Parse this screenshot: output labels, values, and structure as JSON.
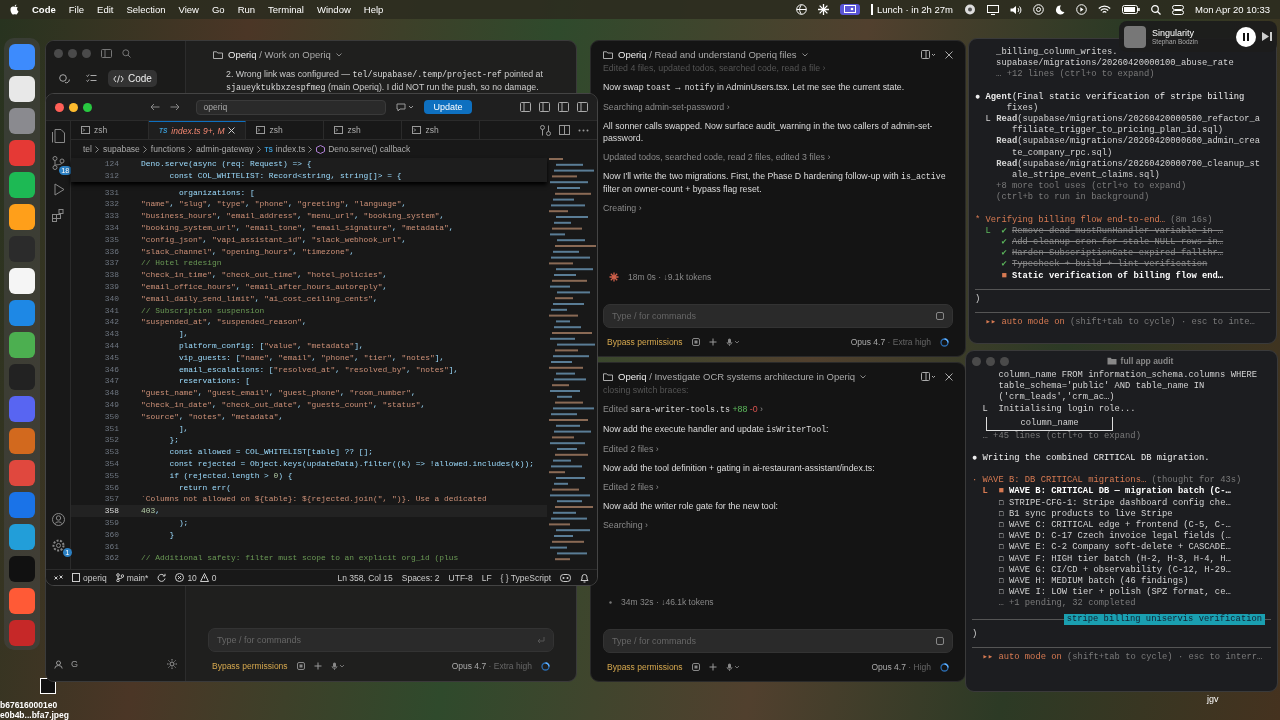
{
  "menubar": {
    "app_name": "Code",
    "menus": [
      "File",
      "Edit",
      "Selection",
      "View",
      "Go",
      "Run",
      "Terminal",
      "Window",
      "Help"
    ],
    "event": "Lunch · in 2h 27m",
    "clock": "Mon Apr 20  10:33"
  },
  "now_playing": {
    "title": "Singularity",
    "artist": "Stephan Bodzin"
  },
  "desktop_files": [
    "b676160001e0",
    "e0b4b...bfa7.jpeg",
    "jgv"
  ],
  "back_window": {
    "title": "**Operiq** / Work on Operiq",
    "mode_tabs": [
      {
        "kind": "chat",
        "selected": false
      },
      {
        "kind": "tasks",
        "selected": false
      },
      {
        "kind": "code",
        "label": "Code",
        "selected": true
      }
    ],
    "account_initial": "G",
    "message": [
      {
        "kind": "plain",
        "text": "2. Wrong link was configured — "
      },
      {
        "kind": "code",
        "text": "tel/supabase/.temp/project-ref"
      },
      {
        "kind": "plain",
        "text": " pointed at "
      },
      {
        "kind": "code",
        "text": "sjaueyktukbxzespfmeg"
      },
      {
        "kind": "plain",
        "text": " (main Operiq). I did NOT run the push, so no damage."
      }
    ],
    "input_placeholder": "Type / for commands",
    "mode": "Bypass permissions",
    "model": "Opus 4.7",
    "effort": "· Extra high"
  },
  "vscode": {
    "search": "operiq",
    "update_button": "Update",
    "tabs": [
      {
        "kind": "terminal",
        "label": "zsh",
        "selected": false
      },
      {
        "kind": "typescript",
        "icon_text": "TS",
        "label": "index.ts",
        "badge": "9+, M",
        "selected": true
      },
      {
        "kind": "terminal",
        "label": "zsh",
        "selected": false
      },
      {
        "kind": "terminal",
        "label": "zsh",
        "selected": false
      },
      {
        "kind": "terminal",
        "label": "zsh",
        "selected": false
      }
    ],
    "breadcrumb": [
      {
        "kind": "folder",
        "label": "tel"
      },
      {
        "kind": "folder",
        "label": "supabase"
      },
      {
        "kind": "folder",
        "label": "functions"
      },
      {
        "kind": "folder",
        "label": "admin-gateway"
      },
      {
        "kind": "typescript",
        "icon_text": "TS",
        "label": "index.ts"
      },
      {
        "kind": "symbol",
        "label": "Deno.serve() callback"
      }
    ],
    "activity_bar": [
      {
        "kind": "explorer"
      },
      {
        "kind": "source_control",
        "badge": "18"
      },
      {
        "kind": "debug"
      },
      {
        "kind": "extensions"
      },
      {
        "kind": "account"
      },
      {
        "kind": "settings",
        "badge": "1"
      }
    ],
    "sticky_lines": [
      {
        "n": "124",
        "text": "Deno.serve(async (req: Request) => {"
      },
      {
        "n": "312",
        "text": "      const COL_WHITELIST: Record<string, string[]> = {"
      }
    ],
    "lines": [
      {
        "n": "331",
        "text": "        organizations: [",
        "current": false
      },
      {
        "n": "332",
        "text": "          \"name\", \"slug\", \"type\", \"phone\", \"greeting\", \"language\",",
        "current": false
      },
      {
        "n": "333",
        "text": "          \"business_hours\", \"email_address\", \"menu_url\", \"booking_system\",",
        "current": false
      },
      {
        "n": "334",
        "text": "          \"booking_system_url\", \"email_tone\", \"email_signature\", \"metadata\",",
        "current": false
      },
      {
        "n": "335",
        "text": "          \"config_json\", \"vapi_assistant_id\", \"slack_webhook_url\",",
        "current": false
      },
      {
        "n": "336",
        "text": "          \"slack_channel\", \"opening_hours\", \"timezone\",",
        "current": false
      },
      {
        "n": "337",
        "text": "          // Hotel redesign",
        "current": false
      },
      {
        "n": "338",
        "text": "          \"check_in_time\", \"check_out_time\", \"hotel_policies\",",
        "current": false
      },
      {
        "n": "339",
        "text": "          \"email_office_hours\", \"email_after_hours_autoreply\",",
        "current": false
      },
      {
        "n": "340",
        "text": "          \"email_daily_send_limit\", \"ai_cost_ceiling_cents\",",
        "current": false
      },
      {
        "n": "341",
        "text": "          // Subscription suspension",
        "current": false
      },
      {
        "n": "342",
        "text": "          \"suspended_at\", \"suspended_reason\",",
        "current": false
      },
      {
        "n": "343",
        "text": "        ],",
        "current": false
      },
      {
        "n": "344",
        "text": "        platform_config: [\"value\", \"metadata\"],",
        "current": false
      },
      {
        "n": "345",
        "text": "        vip_guests: [\"name\", \"email\", \"phone\", \"tier\", \"notes\"],",
        "current": false
      },
      {
        "n": "346",
        "text": "        email_escalations: [\"resolved_at\", \"resolved_by\", \"notes\"],",
        "current": false
      },
      {
        "n": "347",
        "text": "        reservations: [",
        "current": false
      },
      {
        "n": "348",
        "text": "          \"guest_name\", \"guest_email\", \"guest_phone\", \"room_number\",",
        "current": false
      },
      {
        "n": "349",
        "text": "          \"check_in_date\", \"check_out_date\", \"guests_count\", \"status\",",
        "current": false
      },
      {
        "n": "350",
        "text": "          \"source\", \"notes\", \"metadata\",",
        "current": false
      },
      {
        "n": "351",
        "text": "        ],",
        "current": false
      },
      {
        "n": "352",
        "text": "      };",
        "current": false
      },
      {
        "n": "353",
        "text": "      const allowed = COL_WHITELIST[table] ?? [];",
        "current": false
      },
      {
        "n": "354",
        "text": "      const rejected = Object.keys(updateData).filter((k) => !allowed.includes(k));",
        "current": false
      },
      {
        "n": "355",
        "text": "      if (rejected.length > 0) {",
        "current": false
      },
      {
        "n": "356",
        "text": "        return err(",
        "current": false
      },
      {
        "n": "357",
        "text": "          `Columns not allowed on ${table}: ${rejected.join(\", \")}. Use a dedicated",
        "current": false
      },
      {
        "n": "358",
        "text": "          403,",
        "current": true
      },
      {
        "n": "359",
        "text": "        );",
        "current": false
      },
      {
        "n": "360",
        "text": "      }",
        "current": false
      },
      {
        "n": "361",
        "current": false
      },
      {
        "n": "362",
        "text": "      // Additional safety: filter must scope to an explicit org_id (plus",
        "current": false
      }
    ],
    "status": {
      "repo": "operiq",
      "branch": "main*",
      "errors": "10",
      "warnings": "0",
      "position": "Ln 358, Col 15",
      "indent": "Spaces: 2",
      "encoding": "UTF-8",
      "eol": "LF",
      "language_icon": "{ }",
      "language": "TypeScript"
    }
  },
  "chat_panels": [
    {
      "title": "**Operiq** / Read and understand Operiq files",
      "messages": [
        {
          "kind": "faded",
          "parts": [
            {
              "kind": "plain",
              "text": "Edited 4 files, updated todos, searched code, read a file ›"
            }
          ]
        },
        {
          "kind": "text",
          "parts": [
            {
              "kind": "plain",
              "text": "Now swap "
            },
            {
              "kind": "code",
              "text": "toast"
            },
            {
              "kind": "plain",
              "text": " → "
            },
            {
              "kind": "code",
              "text": "notify"
            },
            {
              "kind": "plain",
              "text": " in AdminUsers.tsx. Let me see the current state."
            }
          ]
        },
        {
          "kind": "tool",
          "parts": [
            {
              "kind": "plain",
              "text": "Searching admin-set-password ›"
            }
          ]
        },
        {
          "kind": "text",
          "parts": [
            {
              "kind": "plain",
              "text": "All sonner calls swapped. Now surface audit_warning in the two callers of admin-set-password."
            }
          ]
        },
        {
          "kind": "tool",
          "parts": [
            {
              "kind": "plain",
              "text": "Updated todos, searched code, read 2 files, edited 3 files ›"
            }
          ]
        },
        {
          "kind": "text",
          "parts": [
            {
              "kind": "plain",
              "text": "Now I'll write the two migrations. First, the Phase D hardening follow-up with "
            },
            {
              "kind": "code",
              "text": "is_active"
            },
            {
              "kind": "plain",
              "text": " filter on owner-count + bypass flag reset."
            }
          ]
        },
        {
          "kind": "tool",
          "parts": [
            {
              "kind": "plain",
              "text": "Creating ›"
            }
          ]
        }
      ],
      "stats": "18m 0s · ↓9.1k tokens",
      "working": true,
      "input_placeholder": "Type / for commands",
      "mode": "Bypass permissions",
      "model": "Opus 4.7",
      "effort": "· Extra high"
    },
    {
      "title": "**Operiq** / Investigate OCR systems architecture in Operiq",
      "messages": [
        {
          "kind": "faded",
          "parts": [
            {
              "kind": "plain",
              "text": "closing switch braces:"
            }
          ]
        },
        {
          "kind": "tool",
          "parts": [
            {
              "kind": "plain",
              "text": "Edited "
            },
            {
              "kind": "code",
              "text": "sara-writer-tools.ts"
            },
            {
              "kind": "added",
              "text": " +88"
            },
            {
              "kind": "removed",
              "text": " -0"
            },
            {
              "kind": "plain",
              "text": " ›"
            }
          ]
        },
        {
          "kind": "text",
          "parts": [
            {
              "kind": "plain",
              "text": "Now add the execute handler and update "
            },
            {
              "kind": "code",
              "text": "isWriterTool"
            },
            {
              "kind": "plain",
              "text": ":"
            }
          ]
        },
        {
          "kind": "tool",
          "parts": [
            {
              "kind": "plain",
              "text": "Edited 2 files ›"
            }
          ]
        },
        {
          "kind": "text",
          "parts": [
            {
              "kind": "plain",
              "text": "Now add the tool definition + gating in ai-restaurant-assistant/index.ts:"
            }
          ]
        },
        {
          "kind": "tool",
          "parts": [
            {
              "kind": "plain",
              "text": "Edited 2 files ›"
            }
          ]
        },
        {
          "kind": "text",
          "parts": [
            {
              "kind": "plain",
              "text": "Now add the writer role gate for the new tool:"
            }
          ]
        },
        {
          "kind": "tool",
          "parts": [
            {
              "kind": "plain",
              "text": "Searching ›"
            }
          ]
        }
      ],
      "stats": "34m 32s · ↓46.1k tokens",
      "working": false,
      "input_placeholder": "Type / for commands",
      "mode": "Bypass permissions",
      "model": "Opus 4.7",
      "effort": "· High"
    }
  ],
  "terminals": [
    {
      "lines": [
        {
          "kind": "out",
          "text": "    _billing_column_writes."
        },
        {
          "kind": "out",
          "text": "    supabase/migrations/20260420000100_abuse_rate"
        },
        {
          "kind": "dim",
          "text": "    … +12 lines (ctrl+o to expand)"
        },
        {
          "kind": "agent",
          "text": "● **Agent**(Final static verification of stripe billing"
        },
        {
          "kind": "out",
          "text": "      fixes)"
        },
        {
          "kind": "tool",
          "text": "  L **Read**(supabase/migrations/20260420000500_refactor_a"
        },
        {
          "kind": "out",
          "text": "       ffiliate_trigger_to_pricing_plan_id.sql)"
        },
        {
          "kind": "tool",
          "text": "    **Read**(supabase/migrations/20260420000600_admin_crea"
        },
        {
          "kind": "out",
          "text": "       te_company_rpc.sql)"
        },
        {
          "kind": "tool",
          "text": "    **Read**(supabase/migrations/20260420000700_cleanup_st"
        },
        {
          "kind": "out",
          "text": "       ale_stripe_event_claims.sql)"
        },
        {
          "kind": "dim",
          "text": "    +8 more tool uses (ctrl+o to expand)"
        },
        {
          "kind": "dim",
          "text": "    (ctrl+b to run in background)"
        },
        {
          "kind": "task",
          "text": "* Verifying billing flow end-to-end…",
          "meta": "(8m 16s)"
        },
        {
          "kind": "done",
          "prefix": "  L  ✔",
          "text": "Remove dead mustRunHandler variable in …"
        },
        {
          "kind": "done",
          "prefix": "     ✔",
          "text": "Add cleanup cron for stale NULL rows in…"
        },
        {
          "kind": "done",
          "prefix": "     ✔",
          "text": "Harden SubscriptionGate expired fallthr…"
        },
        {
          "kind": "done",
          "prefix": "     ✔",
          "text": "Typecheck + build + lint verification"
        },
        {
          "kind": "current",
          "prefix": "     ■",
          "text": "Static verification of billing flow end…"
        },
        {
          "kind": "rule"
        },
        {
          "kind": "out",
          "text": ")"
        },
        {
          "kind": "rule"
        },
        {
          "kind": "prompt",
          "mode": "  ▸▸ auto mode on",
          "hint": "(shift+tab to cycle) · esc to inte…"
        }
      ]
    },
    {
      "title": "full app audit",
      "lines": [
        {
          "kind": "out",
          "text": "     column_name FROM information_schema.columns WHERE"
        },
        {
          "kind": "out",
          "text": "     table_schema='public' AND table_name IN"
        },
        {
          "kind": "out",
          "text": "     ('crm_leads','crm_ac…)"
        },
        {
          "kind": "out",
          "text": "  L  Initialising login role..."
        },
        {
          "kind": "box",
          "text": "column_name"
        },
        {
          "kind": "dim",
          "text": "  … +45 lines (ctrl+o to expand)"
        },
        {
          "kind": "agent",
          "text": "● Writing the combined CRITICAL DB migration."
        },
        {
          "kind": "task",
          "text": "· WAVE B: DB CRITICAL migrations…",
          "meta": "(thought for 43s)"
        },
        {
          "kind": "current",
          "prefix": "  L  ■",
          "text": "WAVE B: CRITICAL DB — migration batch (C-…"
        },
        {
          "kind": "todo",
          "prefix": "     ☐",
          "text": "STRIPE-CFG-1: Stripe dashboard config che…"
        },
        {
          "kind": "todo",
          "prefix": "     ☐",
          "text": "B1 sync products to live Stripe"
        },
        {
          "kind": "todo",
          "prefix": "     ☐",
          "text": "WAVE C: CRITICAL edge + frontend (C-5, C-…"
        },
        {
          "kind": "todo",
          "prefix": "     ☐",
          "text": "WAVE D: C-17 Czech invoice legal fields (…"
        },
        {
          "kind": "todo",
          "prefix": "     ☐",
          "text": "WAVE E: C-2 Company soft-delete + CASCADE…"
        },
        {
          "kind": "todo",
          "prefix": "     ☐",
          "text": "WAVE F: HIGH tier batch (H-2, H-3, H-4, H…"
        },
        {
          "kind": "todo",
          "prefix": "     ☐",
          "text": "WAVE G: CI/CD + observability (C-12, H-29…"
        },
        {
          "kind": "todo",
          "prefix": "     ☐",
          "text": "WAVE H: MEDIUM batch (46 findings)"
        },
        {
          "kind": "todo",
          "prefix": "     ☐",
          "text": "WAVE I: LOW tier + polish (SPZ format, ce…"
        },
        {
          "kind": "dim",
          "text": "     … +1 pending, 32 completed"
        },
        {
          "kind": "label_rule",
          "text": "stripe billing uniservis verification"
        },
        {
          "kind": "out",
          "text": ")"
        },
        {
          "kind": "rule"
        },
        {
          "kind": "prompt",
          "mode": "  ▸▸ auto mode on",
          "hint": "(shift+tab to cycle) · esc to interr…"
        }
      ]
    }
  ]
}
